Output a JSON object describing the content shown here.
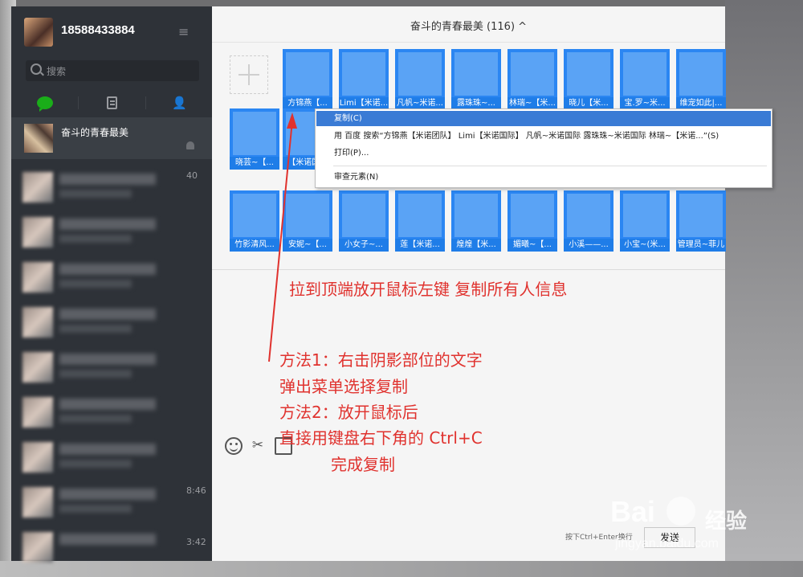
{
  "sidebar": {
    "username": "18588433884",
    "menu_icon": "≡",
    "search_placeholder": "搜索",
    "selected_chat": "奋斗的青春最美",
    "blurred_times": [
      "40",
      "8:46",
      "3:42"
    ]
  },
  "window": {
    "title": "奋斗的青春最美 (116)",
    "title_arrow": "^"
  },
  "members": [
    {
      "name": "方锦燕【..."
    },
    {
      "name": "Limi【米诺..."
    },
    {
      "name": "凡帆~米诺..."
    },
    {
      "name": "露珠珠~..."
    },
    {
      "name": "林瑞~【米..."
    },
    {
      "name": "晓儿【米..."
    },
    {
      "name": "宝.罗~米..."
    },
    {
      "name": "维宠如此|..."
    },
    {
      "name": "晓芸~【..."
    },
    {
      "name": "【米诺国..."
    },
    {
      "name": "竹影清风..."
    },
    {
      "name": "安妮~【..."
    },
    {
      "name": "小女子~..."
    },
    {
      "name": "莲【米诺..."
    },
    {
      "name": "煌煌【米..."
    },
    {
      "name": "媚曦~【..."
    },
    {
      "name": "小溪——..."
    },
    {
      "name": "小宝~(米..."
    },
    {
      "name": "管理员~菲儿"
    }
  ],
  "context_menu": {
    "copy": "复制(C)",
    "search": "用 百度 搜索“方锦燕【米诺团队】 Limi【米诺国际】 凡帆~米诺国际 露珠珠~米诺国际 林瑞~【米诺...”(S)",
    "print": "打印(P)...",
    "inspect": "审查元素(N)"
  },
  "annotations": {
    "line1": "拉到顶端放开鼠标左键 复制所有人信息",
    "line2": "方法1：右击阴影部位的文字",
    "line3": "弹出菜单选择复制",
    "line4": "方法2：放开鼠标后",
    "line5": "直接用键盘右下角的 Ctrl+C",
    "line6": "完成复制"
  },
  "input": {
    "send_hint": "按下Ctrl+Enter换行",
    "send_label": "发送"
  },
  "watermark": {
    "brand": "Bai",
    "brand2": "经验",
    "url": "jingyan.baidu.com"
  },
  "colors": {
    "selection_blue": "#2b86f2",
    "sidebar_bg": "#2e3238",
    "annotation_red": "#e0322e",
    "wechat_green": "#1aad19"
  }
}
